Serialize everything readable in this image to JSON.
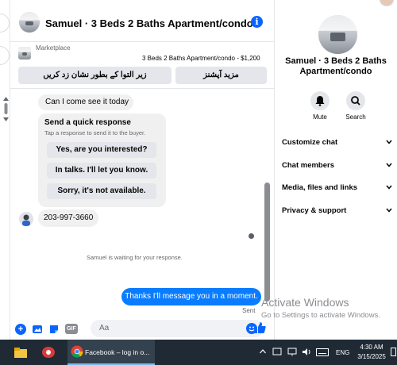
{
  "header": {
    "title": "Samuel · 3 Beds 2 Baths Apartment/condo"
  },
  "marketplace": {
    "label": "Marketplace",
    "listing": "3 Beds 2 Baths Apartment/condo - $1,200",
    "btn_mark": "زیر التوا کے بطور نشان زد کریں",
    "btn_more": "مزید آپشنز"
  },
  "messages": {
    "question": "Can I come see it today ?",
    "quick_title": "Send a quick response",
    "quick_sub": "Tap a response to send it to the buyer.",
    "quick_options": [
      "Yes, are you interested?",
      "In talks. I'll let you know.",
      "Sorry, it's not available."
    ],
    "phone": "203-997-3660",
    "waiting": "Samuel is waiting for your response.",
    "reply": "Thanks I'll message you in a moment.",
    "sent": "Sent"
  },
  "composer": {
    "placeholder": "Aa"
  },
  "right_panel": {
    "title": "Samuel · 3 Beds 2 Baths Apartment/condo",
    "mute": "Mute",
    "search": "Search",
    "menu": [
      "Customize chat",
      "Chat members",
      "Media, files and links",
      "Privacy & support"
    ]
  },
  "watermark": {
    "title": "Activate Windows",
    "sub": "Go to Settings to activate Windows."
  },
  "taskbar": {
    "app_label": "Facebook – log in o...",
    "lang": "ENG",
    "time": "4:30 AM",
    "date": "3/15/2025"
  },
  "colors": {
    "accent": "#0866ff",
    "bubble_mine": "#0a7cff",
    "taskbar": "#1f2a35"
  }
}
